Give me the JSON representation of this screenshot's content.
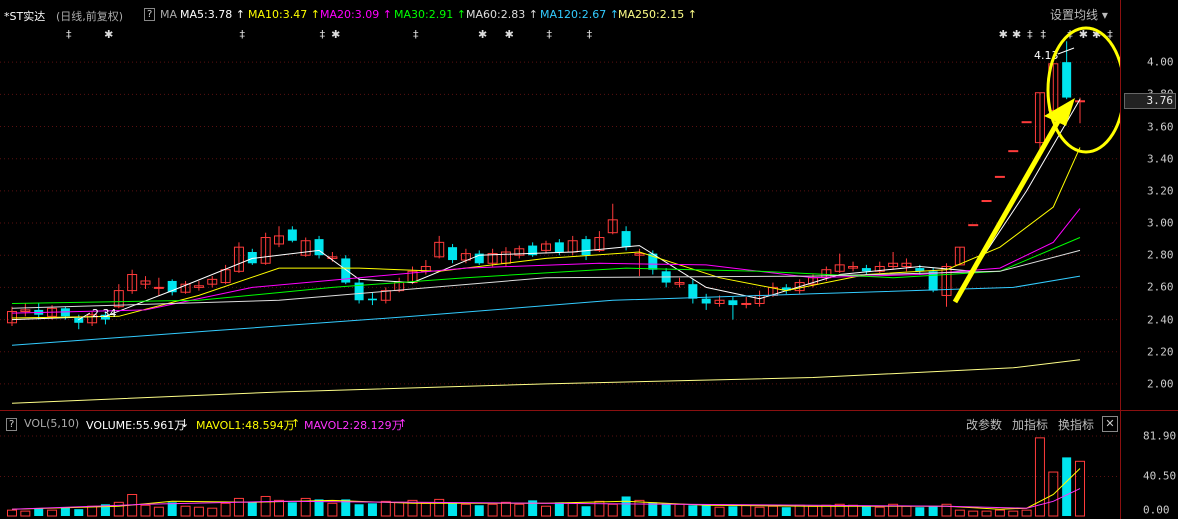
{
  "header": {
    "stock_name": "*ST实达",
    "period": "(日线,前复权)",
    "help": "?",
    "ma_label": "MA",
    "ma": [
      {
        "label": "MA5:3.78",
        "color": "#ffffff"
      },
      {
        "label": "MA10:3.47",
        "color": "#ffff00"
      },
      {
        "label": "MA20:3.09",
        "color": "#ff00ff"
      },
      {
        "label": "MA30:2.91",
        "color": "#00ff00"
      },
      {
        "label": "MA60:2.83",
        "color": "#dddddd"
      },
      {
        "label": "MA120:2.67",
        "color": "#33ccff"
      },
      {
        "label": "MA250:2.15",
        "color": "#ffff88"
      }
    ],
    "arrow": "↑",
    "settings": "设置均线"
  },
  "price_axis": [
    "4.00",
    "3.80",
    "3.60",
    "3.40",
    "3.20",
    "3.00",
    "2.80",
    "2.60",
    "2.40",
    "2.20",
    "2.00"
  ],
  "current_price": "3.76",
  "annotations": {
    "high": "4.13",
    "low": "2.34"
  },
  "volume_panel": {
    "help": "?",
    "title": "VOL(5,10)",
    "volume": "VOLUME:55.961万",
    "volume_arrow": "↓",
    "mavol1": "MAVOL1:48.594万",
    "mavol2": "MAVOL2:28.129万",
    "up_arrow": "↑",
    "btn_params": "改参数",
    "btn_add": "加指标",
    "btn_switch": "换指标",
    "close": "✕",
    "axis": [
      "81.90",
      "40.50",
      "0.00"
    ]
  },
  "colors": {
    "up": "#ff3b3b",
    "down": "#00e5ee",
    "grid": "#5a1010",
    "highlight": "#ffff00"
  },
  "chart_data": {
    "type": "candlestick",
    "ylim": [
      1.9,
      4.2
    ],
    "vol_max": 81.9,
    "candles": [
      [
        2.38,
        2.45,
        2.48,
        2.36,
        6
      ],
      [
        2.45,
        2.46,
        2.5,
        2.42,
        5
      ],
      [
        2.46,
        2.43,
        2.5,
        2.4,
        8
      ],
      [
        2.42,
        2.47,
        2.49,
        2.4,
        6
      ],
      [
        2.47,
        2.42,
        2.48,
        2.4,
        9
      ],
      [
        2.41,
        2.38,
        2.43,
        2.34,
        7
      ],
      [
        2.38,
        2.43,
        2.45,
        2.36,
        10
      ],
      [
        2.43,
        2.4,
        2.45,
        2.37,
        12
      ],
      [
        2.48,
        2.58,
        2.62,
        2.47,
        14
      ],
      [
        2.58,
        2.68,
        2.71,
        2.56,
        22
      ],
      [
        2.62,
        2.64,
        2.67,
        2.59,
        11
      ],
      [
        2.6,
        2.6,
        2.66,
        2.55,
        9
      ],
      [
        2.64,
        2.57,
        2.65,
        2.55,
        14
      ],
      [
        2.57,
        2.62,
        2.64,
        2.56,
        10
      ],
      [
        2.6,
        2.61,
        2.64,
        2.58,
        9
      ],
      [
        2.62,
        2.65,
        2.67,
        2.6,
        8
      ],
      [
        2.63,
        2.71,
        2.74,
        2.62,
        13
      ],
      [
        2.7,
        2.85,
        2.88,
        2.69,
        18
      ],
      [
        2.82,
        2.75,
        2.84,
        2.74,
        14
      ],
      [
        2.75,
        2.91,
        2.94,
        2.74,
        20
      ],
      [
        2.87,
        2.92,
        2.98,
        2.85,
        16
      ],
      [
        2.96,
        2.89,
        2.98,
        2.88,
        14
      ],
      [
        2.8,
        2.89,
        2.91,
        2.79,
        18
      ],
      [
        2.9,
        2.8,
        2.92,
        2.78,
        17
      ],
      [
        2.78,
        2.79,
        2.82,
        2.76,
        13
      ],
      [
        2.78,
        2.63,
        2.8,
        2.62,
        17
      ],
      [
        2.63,
        2.52,
        2.66,
        2.5,
        12
      ],
      [
        2.53,
        2.52,
        2.57,
        2.49,
        13
      ],
      [
        2.52,
        2.58,
        2.6,
        2.5,
        15
      ],
      [
        2.58,
        2.63,
        2.66,
        2.57,
        14
      ],
      [
        2.63,
        2.7,
        2.73,
        2.62,
        16
      ],
      [
        2.7,
        2.73,
        2.77,
        2.68,
        13
      ],
      [
        2.79,
        2.88,
        2.92,
        2.78,
        17
      ],
      [
        2.85,
        2.77,
        2.87,
        2.75,
        13
      ],
      [
        2.77,
        2.81,
        2.84,
        2.75,
        12
      ],
      [
        2.81,
        2.75,
        2.83,
        2.74,
        11
      ],
      [
        2.75,
        2.81,
        2.84,
        2.73,
        12
      ],
      [
        2.75,
        2.82,
        2.85,
        2.73,
        14
      ],
      [
        2.8,
        2.84,
        2.86,
        2.78,
        12
      ],
      [
        2.86,
        2.8,
        2.88,
        2.79,
        16
      ],
      [
        2.83,
        2.87,
        2.89,
        2.81,
        10
      ],
      [
        2.88,
        2.82,
        2.9,
        2.8,
        14
      ],
      [
        2.82,
        2.89,
        2.92,
        2.8,
        13
      ],
      [
        2.9,
        2.8,
        2.92,
        2.77,
        10
      ],
      [
        2.83,
        2.91,
        2.95,
        2.82,
        15
      ],
      [
        2.94,
        3.02,
        3.12,
        2.93,
        12
      ],
      [
        2.95,
        2.85,
        2.98,
        2.83,
        20
      ],
      [
        2.8,
        2.81,
        2.84,
        2.67,
        16
      ],
      [
        2.81,
        2.71,
        2.83,
        2.68,
        14
      ],
      [
        2.7,
        2.63,
        2.72,
        2.6,
        13
      ],
      [
        2.62,
        2.63,
        2.66,
        2.6,
        12
      ],
      [
        2.62,
        2.53,
        2.65,
        2.5,
        11
      ],
      [
        2.53,
        2.5,
        2.56,
        2.46,
        12
      ],
      [
        2.5,
        2.52,
        2.55,
        2.48,
        9
      ],
      [
        2.52,
        2.49,
        2.54,
        2.4,
        10
      ],
      [
        2.5,
        2.5,
        2.54,
        2.47,
        11
      ],
      [
        2.5,
        2.55,
        2.58,
        2.48,
        9
      ],
      [
        2.55,
        2.6,
        2.63,
        2.54,
        10
      ],
      [
        2.6,
        2.58,
        2.62,
        2.56,
        9
      ],
      [
        2.58,
        2.63,
        2.65,
        2.56,
        11
      ],
      [
        2.62,
        2.66,
        2.68,
        2.6,
        10
      ],
      [
        2.66,
        2.71,
        2.73,
        2.64,
        11
      ],
      [
        2.7,
        2.74,
        2.81,
        2.69,
        12
      ],
      [
        2.72,
        2.73,
        2.76,
        2.7,
        11
      ],
      [
        2.72,
        2.7,
        2.74,
        2.68,
        10
      ],
      [
        2.7,
        2.73,
        2.76,
        2.69,
        9
      ],
      [
        2.73,
        2.75,
        2.82,
        2.71,
        12
      ],
      [
        2.73,
        2.75,
        2.78,
        2.7,
        10
      ],
      [
        2.72,
        2.7,
        2.74,
        2.68,
        9
      ],
      [
        2.7,
        2.58,
        2.72,
        2.57,
        10
      ],
      [
        2.55,
        2.73,
        2.75,
        2.48,
        12
      ],
      [
        2.74,
        2.85,
        2.85,
        2.74,
        6
      ],
      [
        2.99,
        2.99,
        2.99,
        2.99,
        5
      ],
      [
        3.14,
        3.14,
        3.14,
        3.14,
        5
      ],
      [
        3.29,
        3.29,
        3.29,
        3.29,
        6
      ],
      [
        3.45,
        3.45,
        3.45,
        3.45,
        5
      ],
      [
        3.63,
        3.63,
        3.63,
        3.63,
        6
      ],
      [
        3.5,
        3.81,
        3.81,
        3.45,
        80
      ],
      [
        3.7,
        3.99,
        3.99,
        3.66,
        45
      ],
      [
        4.0,
        3.78,
        4.13,
        3.77,
        60
      ],
      [
        3.76,
        3.76,
        3.78,
        3.62,
        56
      ]
    ],
    "ma_lines": [
      {
        "name": "MA5",
        "values": [
          [
            0,
            2.4
          ],
          [
            7,
            2.42
          ],
          [
            12,
            2.58
          ],
          [
            18,
            2.78
          ],
          [
            23,
            2.83
          ],
          [
            26,
            2.65
          ],
          [
            30,
            2.63
          ],
          [
            35,
            2.8
          ],
          [
            42,
            2.82
          ],
          [
            47,
            2.86
          ],
          [
            52,
            2.6
          ],
          [
            56,
            2.53
          ],
          [
            62,
            2.68
          ],
          [
            68,
            2.73
          ],
          [
            72,
            2.7
          ],
          [
            76,
            3.2
          ],
          [
            80,
            3.77
          ]
        ]
      },
      {
        "name": "MA10",
        "values": [
          [
            0,
            2.41
          ],
          [
            8,
            2.42
          ],
          [
            14,
            2.55
          ],
          [
            20,
            2.72
          ],
          [
            26,
            2.72
          ],
          [
            32,
            2.7
          ],
          [
            40,
            2.78
          ],
          [
            47,
            2.82
          ],
          [
            53,
            2.66
          ],
          [
            58,
            2.58
          ],
          [
            64,
            2.68
          ],
          [
            70,
            2.71
          ],
          [
            74,
            2.85
          ],
          [
            78,
            3.1
          ],
          [
            80,
            3.47
          ]
        ]
      },
      {
        "name": "MA20",
        "values": [
          [
            0,
            2.44
          ],
          [
            10,
            2.46
          ],
          [
            18,
            2.6
          ],
          [
            26,
            2.66
          ],
          [
            34,
            2.72
          ],
          [
            44,
            2.75
          ],
          [
            52,
            2.74
          ],
          [
            60,
            2.66
          ],
          [
            68,
            2.68
          ],
          [
            74,
            2.72
          ],
          [
            78,
            2.88
          ],
          [
            80,
            3.09
          ]
        ]
      },
      {
        "name": "MA30",
        "values": [
          [
            0,
            2.5
          ],
          [
            14,
            2.52
          ],
          [
            24,
            2.6
          ],
          [
            34,
            2.66
          ],
          [
            46,
            2.72
          ],
          [
            56,
            2.7
          ],
          [
            66,
            2.66
          ],
          [
            74,
            2.7
          ],
          [
            80,
            2.91
          ]
        ]
      },
      {
        "name": "MA60",
        "values": [
          [
            0,
            2.47
          ],
          [
            20,
            2.52
          ],
          [
            40,
            2.66
          ],
          [
            60,
            2.67
          ],
          [
            74,
            2.7
          ],
          [
            80,
            2.83
          ]
        ]
      },
      {
        "name": "MA120",
        "values": [
          [
            0,
            2.24
          ],
          [
            15,
            2.33
          ],
          [
            30,
            2.42
          ],
          [
            45,
            2.52
          ],
          [
            60,
            2.56
          ],
          [
            75,
            2.6
          ],
          [
            80,
            2.67
          ]
        ]
      },
      {
        "name": "MA250",
        "values": [
          [
            0,
            1.88
          ],
          [
            20,
            1.95
          ],
          [
            40,
            2.0
          ],
          [
            60,
            2.04
          ],
          [
            75,
            2.1
          ],
          [
            80,
            2.15
          ]
        ]
      }
    ],
    "vol_ma": [
      {
        "name": "MAVOL1",
        "values": [
          [
            0,
            7
          ],
          [
            8,
            10
          ],
          [
            12,
            15
          ],
          [
            18,
            14
          ],
          [
            24,
            16
          ],
          [
            30,
            13
          ],
          [
            40,
            13
          ],
          [
            46,
            15
          ],
          [
            52,
            11
          ],
          [
            60,
            10
          ],
          [
            70,
            10
          ],
          [
            74,
            7
          ],
          [
            76,
            8
          ],
          [
            78,
            22
          ],
          [
            80,
            48.6
          ]
        ]
      },
      {
        "name": "MAVOL2",
        "values": [
          [
            0,
            7
          ],
          [
            10,
            12
          ],
          [
            20,
            15
          ],
          [
            30,
            14
          ],
          [
            40,
            13
          ],
          [
            50,
            12
          ],
          [
            60,
            11
          ],
          [
            70,
            10
          ],
          [
            76,
            8
          ],
          [
            78,
            15
          ],
          [
            80,
            28.1
          ]
        ]
      }
    ],
    "markers": [
      {
        "i": 2,
        "s": "‡"
      },
      {
        "i": 5,
        "s": "✱"
      },
      {
        "i": 15,
        "s": "‡"
      },
      {
        "i": 21,
        "s": "‡"
      },
      {
        "i": 22,
        "s": "✱"
      },
      {
        "i": 28,
        "s": "‡"
      },
      {
        "i": 33,
        "s": "✱"
      },
      {
        "i": 35,
        "s": "✱"
      },
      {
        "i": 38,
        "s": "‡"
      },
      {
        "i": 41,
        "s": "‡"
      },
      {
        "i": 72,
        "s": "✱"
      },
      {
        "i": 73,
        "s": "✱"
      },
      {
        "i": 74,
        "s": "‡"
      },
      {
        "i": 75,
        "s": "‡"
      },
      {
        "i": 77,
        "s": "‡"
      },
      {
        "i": 78,
        "s": "✱"
      },
      {
        "i": 79,
        "s": "✱"
      },
      {
        "i": 80,
        "s": "‡"
      }
    ]
  }
}
